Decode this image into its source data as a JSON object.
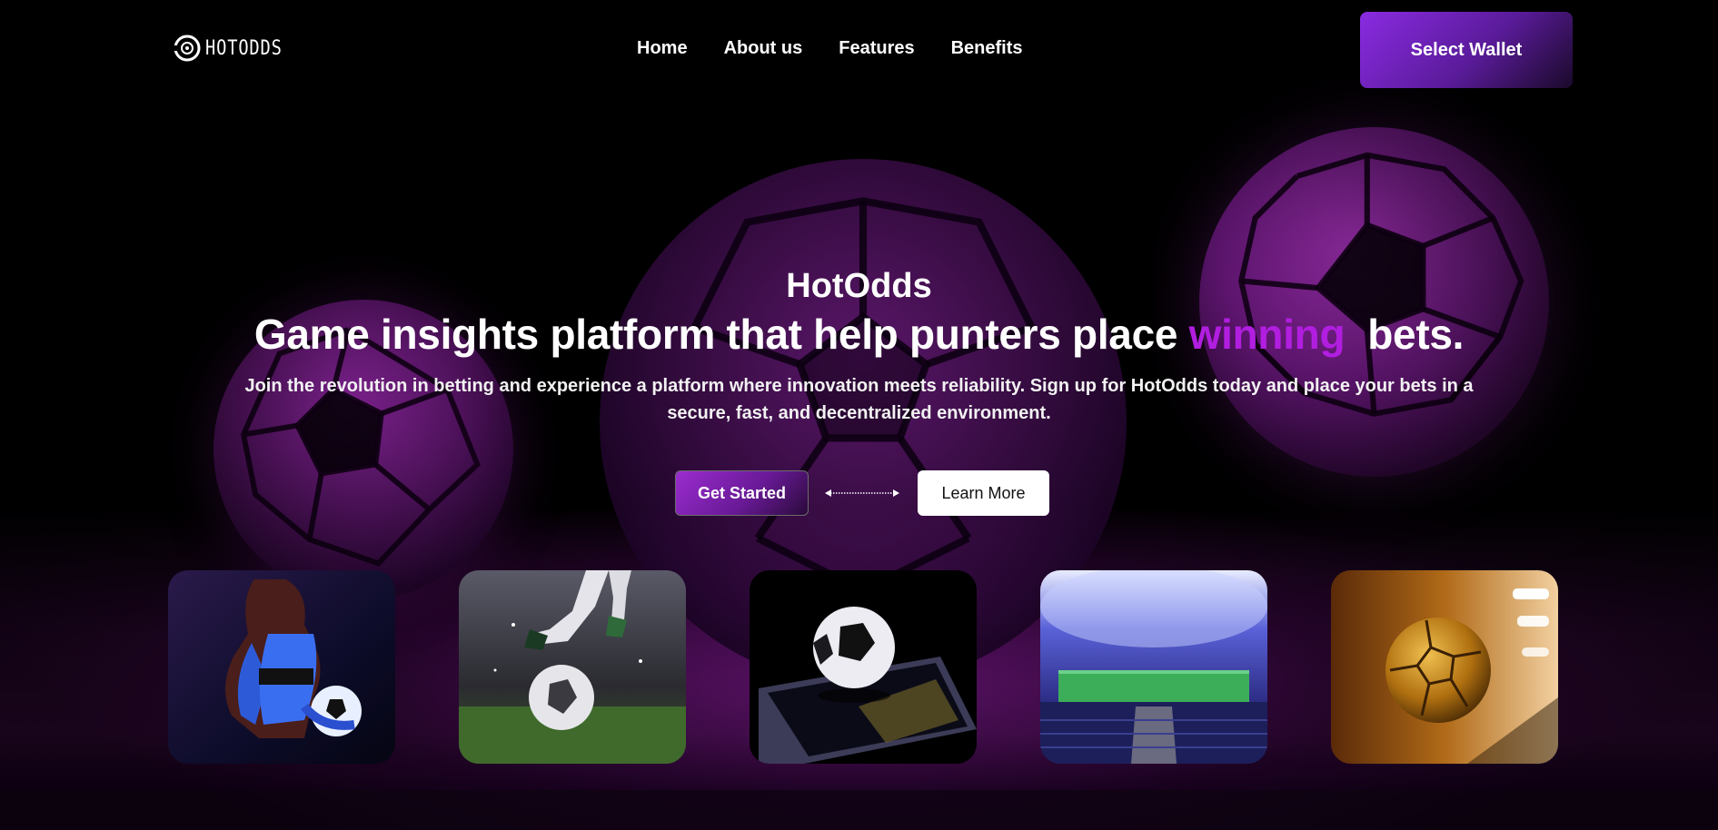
{
  "header": {
    "logo_text": "HOTODDS",
    "nav": [
      {
        "label": "Home"
      },
      {
        "label": "About us"
      },
      {
        "label": "Features"
      },
      {
        "label": "Benefits"
      }
    ],
    "wallet_button": "Select Wallet"
  },
  "hero": {
    "brand": "HotOdds",
    "headline_before": "Game insights platform that help punters place ",
    "headline_accent": "winning",
    "headline_after": "  bets.",
    "subtitle": "Join the revolution in betting and experience a platform where innovation meets reliability. Sign up for HotOdds today and place your bets in a secure, fast, and decentralized environment.",
    "primary_cta": "Get Started",
    "secondary_cta": "Learn More"
  },
  "gallery": [
    {
      "icon": "woman-with-soccer-ball-image"
    },
    {
      "icon": "player-kicking-ball-image"
    },
    {
      "icon": "ball-on-smartphone-image"
    },
    {
      "icon": "stadium-image"
    },
    {
      "icon": "golden-ball-image"
    }
  ],
  "colors": {
    "accent": "#b11ee0",
    "wallet_gradient_start": "#8a2be2",
    "background": "#000000"
  }
}
